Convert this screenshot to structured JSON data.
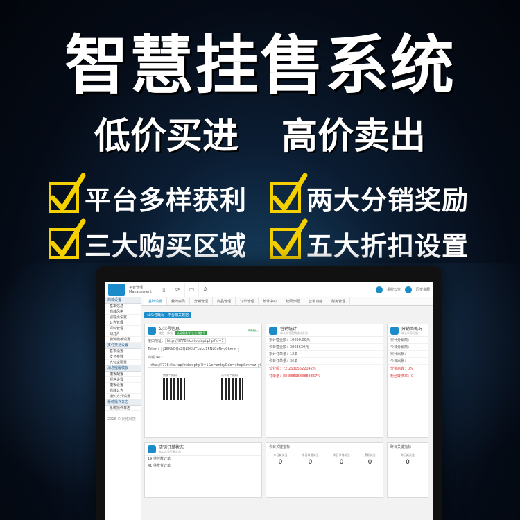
{
  "headline": "智慧挂售系统",
  "subline": [
    "低价买进",
    "高价卖出"
  ],
  "features": [
    [
      "平台多样获利",
      "两大分销奖励"
    ],
    [
      "三大购买区域",
      "五大折扣设置"
    ]
  ],
  "colors": {
    "check": "#f5d000",
    "accent": "#1b8cc9"
  },
  "app": {
    "brand": "平台管理 Management",
    "top_icons": [
      "手机",
      "分享",
      "显示",
      "设置"
    ],
    "top_right": [
      "系统公告",
      "同步客服"
    ],
    "tabs": [
      "基础设置",
      "我的会员",
      "分销管理",
      "商品管理",
      "订单管理",
      "统计中心",
      "权限分配",
      "营销功能",
      "财务管理"
    ],
    "crumb": "公众号概况 - 平台相关数据",
    "sidebar": [
      {
        "head": "商城设置",
        "items": [
          "基本信息",
          "商城风格",
          "引导页设置",
          "公告管理",
          "评价管理",
          "幻灯片",
          "物流模板设置"
        ]
      },
      {
        "head": "支付交易设置",
        "items": [
          "基本设置",
          "支付参数",
          "支付宝配置"
        ]
      },
      {
        "head": "消息提醒模板",
        "items": [
          "模板配置",
          "短信设置",
          "模板设置",
          "商城公告",
          "通知方式设置"
        ]
      },
      {
        "head": "系统操作日志",
        "items": [
          "系统操作日志"
        ]
      }
    ],
    "sidebar_footer": "2016 © 网络科技",
    "card1": {
      "title": "公众号信息",
      "sub": "域名一体化",
      "badge": "认证服务号/企业微信号",
      "link": "刷新接入",
      "api_label": "接口地址：",
      "api_value": "http://ll778.tko.top/api.php?id=1",
      "token_label": "Token：",
      "token_value": "j15NkOQsZQLD5NT1uLu15NL0eNnv0hmm",
      "url_label": "商城URL：",
      "url_value": "http://ll778.tko.top/index.php?i=1&c=entry&do=shop&m=sz_yi",
      "qr1": "商城二维码",
      "qr2": "公众号二维码"
    },
    "card2": {
      "title": "营销统计",
      "sub": "本公众号营销统计汇总",
      "lines": [
        "累计营业额：10090.00元",
        "今日营业额：3803630元",
        "累计订单量：12单",
        "今日订单量：36单"
      ],
      "red1": "营业额：72.26305522042%",
      "red2": "订单量：88.8889888888867%"
    },
    "card3": {
      "title": "分销商概况",
      "sub": "本公众号分销",
      "lines": [
        "累计分销商：",
        "今日分销商：",
        "累计出账：",
        "今日出账："
      ],
      "red1": "分销商数：0%",
      "red2": "粉丝转换率：0"
    },
    "bottom1": {
      "title": "店铺订单状态",
      "sub": "本公众号订单状态",
      "rows": [
        "19  待付款订单",
        "41  待发货订单"
      ]
    },
    "bottom2": {
      "title": "今日关键指标",
      "stats": [
        {
          "label": "今日新关注",
          "value": "0"
        },
        {
          "label": "今日取消关注",
          "value": "0"
        },
        {
          "label": "今日净增关注",
          "value": "0"
        },
        {
          "label": "累积关注",
          "value": "0"
        }
      ]
    },
    "bottom3": {
      "title": "昨日关键指标",
      "stats": [
        {
          "label": "昨日新关注",
          "value": "0"
        }
      ]
    }
  }
}
